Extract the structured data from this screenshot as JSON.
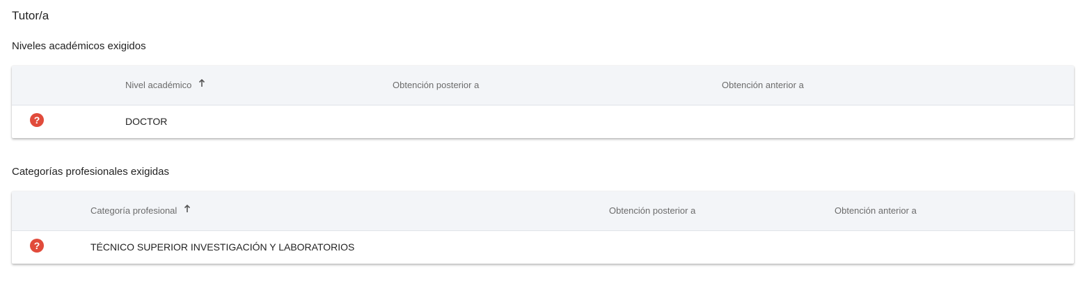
{
  "page": {
    "title": "Tutor/a"
  },
  "academic": {
    "section_title": "Niveles académicos exigidos",
    "columns": {
      "level": "Nivel académico",
      "after": "Obtención posterior a",
      "before": "Obtención anterior a"
    },
    "rows": [
      {
        "icon": "help-icon",
        "level": "DOCTOR",
        "after": "",
        "before": ""
      }
    ]
  },
  "professional": {
    "section_title": "Categorías profesionales exigidas",
    "columns": {
      "category": "Categoría profesional",
      "after": "Obtención posterior a",
      "before": "Obtención anterior a"
    },
    "rows": [
      {
        "icon": "help-icon",
        "category": "TÉCNICO SUPERIOR INVESTIGACIÓN Y LABORATORIOS",
        "after": "",
        "before": ""
      }
    ]
  },
  "icons": {
    "help": "?",
    "sort": "arrow-up-icon"
  },
  "colors": {
    "help_icon": "#e14b3b",
    "header_bg": "#f3f5f8"
  }
}
